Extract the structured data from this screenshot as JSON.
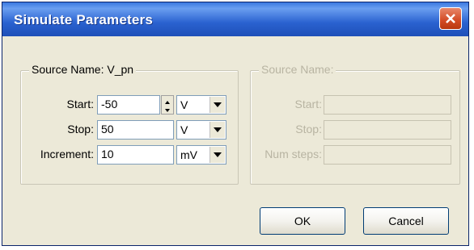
{
  "window": {
    "title": "Simulate Parameters"
  },
  "source_group": {
    "legend": "Source Name: V_pn",
    "rows": [
      {
        "label": "Start:",
        "value": "-50",
        "unit": "V"
      },
      {
        "label": "Stop:",
        "value": "50",
        "unit": "V"
      },
      {
        "label": "Increment:",
        "value": "10",
        "unit": "mV"
      }
    ]
  },
  "source_group_2": {
    "legend": "Source Name:",
    "rows": [
      {
        "label": "Start:",
        "value": ""
      },
      {
        "label": "Stop:",
        "value": ""
      },
      {
        "label": "Num steps:",
        "value": ""
      }
    ]
  },
  "buttons": {
    "ok": "OK",
    "cancel": "Cancel"
  }
}
